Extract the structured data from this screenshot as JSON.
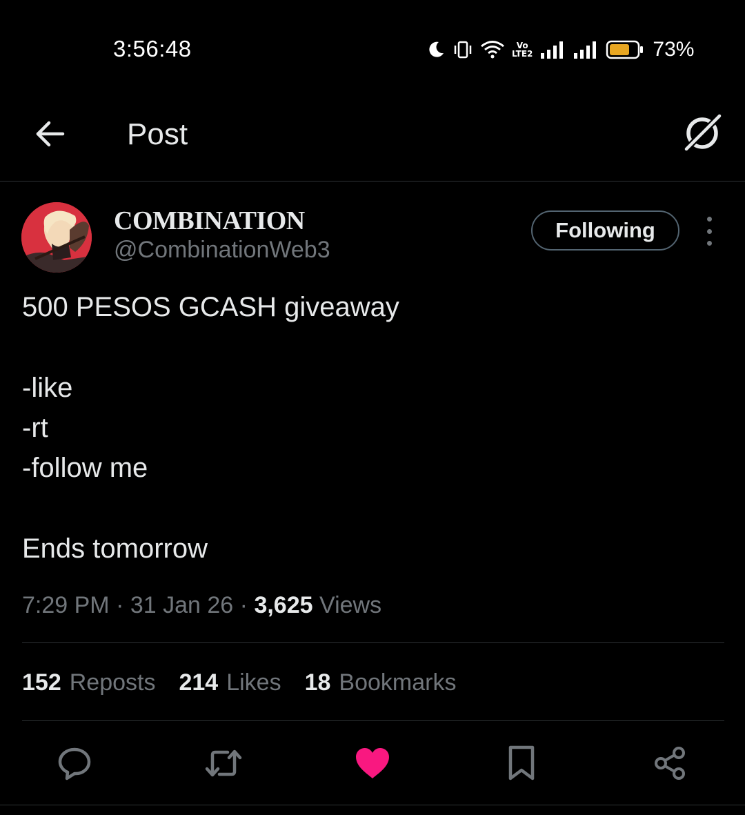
{
  "status_bar": {
    "time": "3:56:48",
    "volte_top": "Vo",
    "volte_bottom": "LTE2",
    "battery_percent": "73%",
    "battery_level": 0.73,
    "battery_color": "#e8a722",
    "icons": [
      "moon-icon",
      "vibrate-icon",
      "wifi-icon",
      "volte-icon",
      "signal-icon",
      "signal-icon",
      "battery-icon"
    ]
  },
  "header": {
    "title": "Post",
    "back_icon": "arrow-left-icon",
    "grok_icon": "grok-icon"
  },
  "author": {
    "display_name": "COMBINATION",
    "handle": "@CombinationWeb3",
    "follow_label": "Following",
    "avatar_bg": "#d8313f"
  },
  "post": {
    "lines": [
      "500 PESOS GCASH giveaway",
      "-like",
      "-rt",
      "-follow me",
      "Ends tomorrow"
    ],
    "time": "7:29 PM",
    "separator": "·",
    "date": "31 Jan 26",
    "views_count": "3,625",
    "views_label": "Views"
  },
  "stats": {
    "reposts_count": "152",
    "reposts_label": "Reposts",
    "likes_count": "214",
    "likes_label": "Likes",
    "bookmarks_count": "18",
    "bookmarks_label": "Bookmarks"
  },
  "actions": {
    "icons": [
      "reply-icon",
      "repost-icon",
      "like-icon",
      "bookmark-icon",
      "share-icon"
    ],
    "liked": true,
    "like_color": "#f91880",
    "icon_color": "#71767b"
  }
}
